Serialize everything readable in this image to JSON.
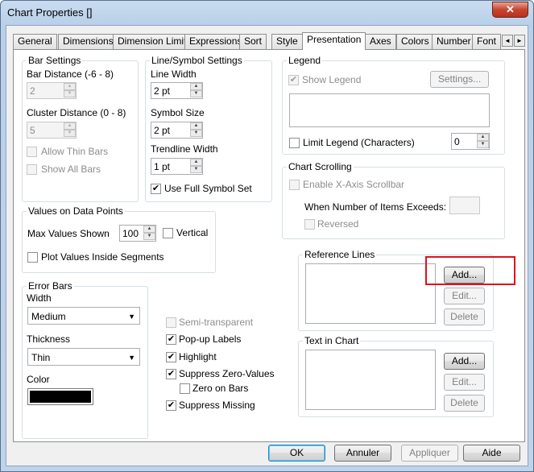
{
  "window": {
    "title": "Chart Properties []",
    "close_glyph": "✕"
  },
  "tabs": [
    "General",
    "Dimensions",
    "Dimension Limits",
    "Expressions",
    "Sort",
    "Style",
    "Presentation",
    "Axes",
    "Colors",
    "Number",
    "Font"
  ],
  "active_tab": "Presentation",
  "tab_scroll": {
    "left": "◄",
    "right": "►"
  },
  "bar_settings": {
    "title": "Bar Settings",
    "bar_distance_label": "Bar Distance (-6 - 8)",
    "bar_distance_value": "2",
    "cluster_distance_label": "Cluster Distance (0 - 8)",
    "cluster_distance_value": "5",
    "allow_thin_bars": "Allow Thin Bars",
    "show_all_bars": "Show All Bars"
  },
  "line_symbol": {
    "title": "Line/Symbol Settings",
    "line_width_label": "Line Width",
    "line_width_value": "2 pt",
    "symbol_size_label": "Symbol Size",
    "symbol_size_value": "2 pt",
    "trendline_width_label": "Trendline Width",
    "trendline_width_value": "1 pt",
    "use_full_symbol_set": "Use Full Symbol Set"
  },
  "legend": {
    "title": "Legend",
    "show_legend": "Show Legend",
    "settings_button": "Settings...",
    "limit_legend": "Limit Legend (Characters)",
    "limit_value": "0"
  },
  "chart_scrolling": {
    "title": "Chart Scrolling",
    "enable_scrollbar": "Enable X-Axis Scrollbar",
    "items_exceeds_label": "When Number of Items Exceeds:",
    "reversed": "Reversed"
  },
  "values_on_points": {
    "title": "Values on Data Points",
    "max_values_label": "Max Values Shown",
    "max_values_value": "100",
    "vertical": "Vertical",
    "plot_inside": "Plot Values Inside Segments"
  },
  "reference_lines": {
    "title": "Reference Lines",
    "add": "Add...",
    "edit": "Edit...",
    "delete": "Delete"
  },
  "text_in_chart": {
    "title": "Text in Chart",
    "add": "Add...",
    "edit": "Edit...",
    "delete": "Delete"
  },
  "error_bars": {
    "title": "Error Bars",
    "width_label": "Width",
    "width_value": "Medium",
    "thickness_label": "Thickness",
    "thickness_value": "Thin",
    "color_label": "Color",
    "color_value": "#000000"
  },
  "options": {
    "semi_transparent": "Semi-transparent",
    "popup_labels": "Pop-up Labels",
    "highlight": "Highlight",
    "suppress_zero": "Suppress Zero-Values",
    "zero_on_bars": "Zero on Bars",
    "suppress_missing": "Suppress Missing"
  },
  "footer": {
    "ok": "OK",
    "cancel": "Annuler",
    "apply": "Appliquer",
    "help": "Aide"
  },
  "checkmark": "✔",
  "spin_up": "▲",
  "spin_down": "▼",
  "dropdown_caret": "▼",
  "highlight_color": "#e0101a"
}
